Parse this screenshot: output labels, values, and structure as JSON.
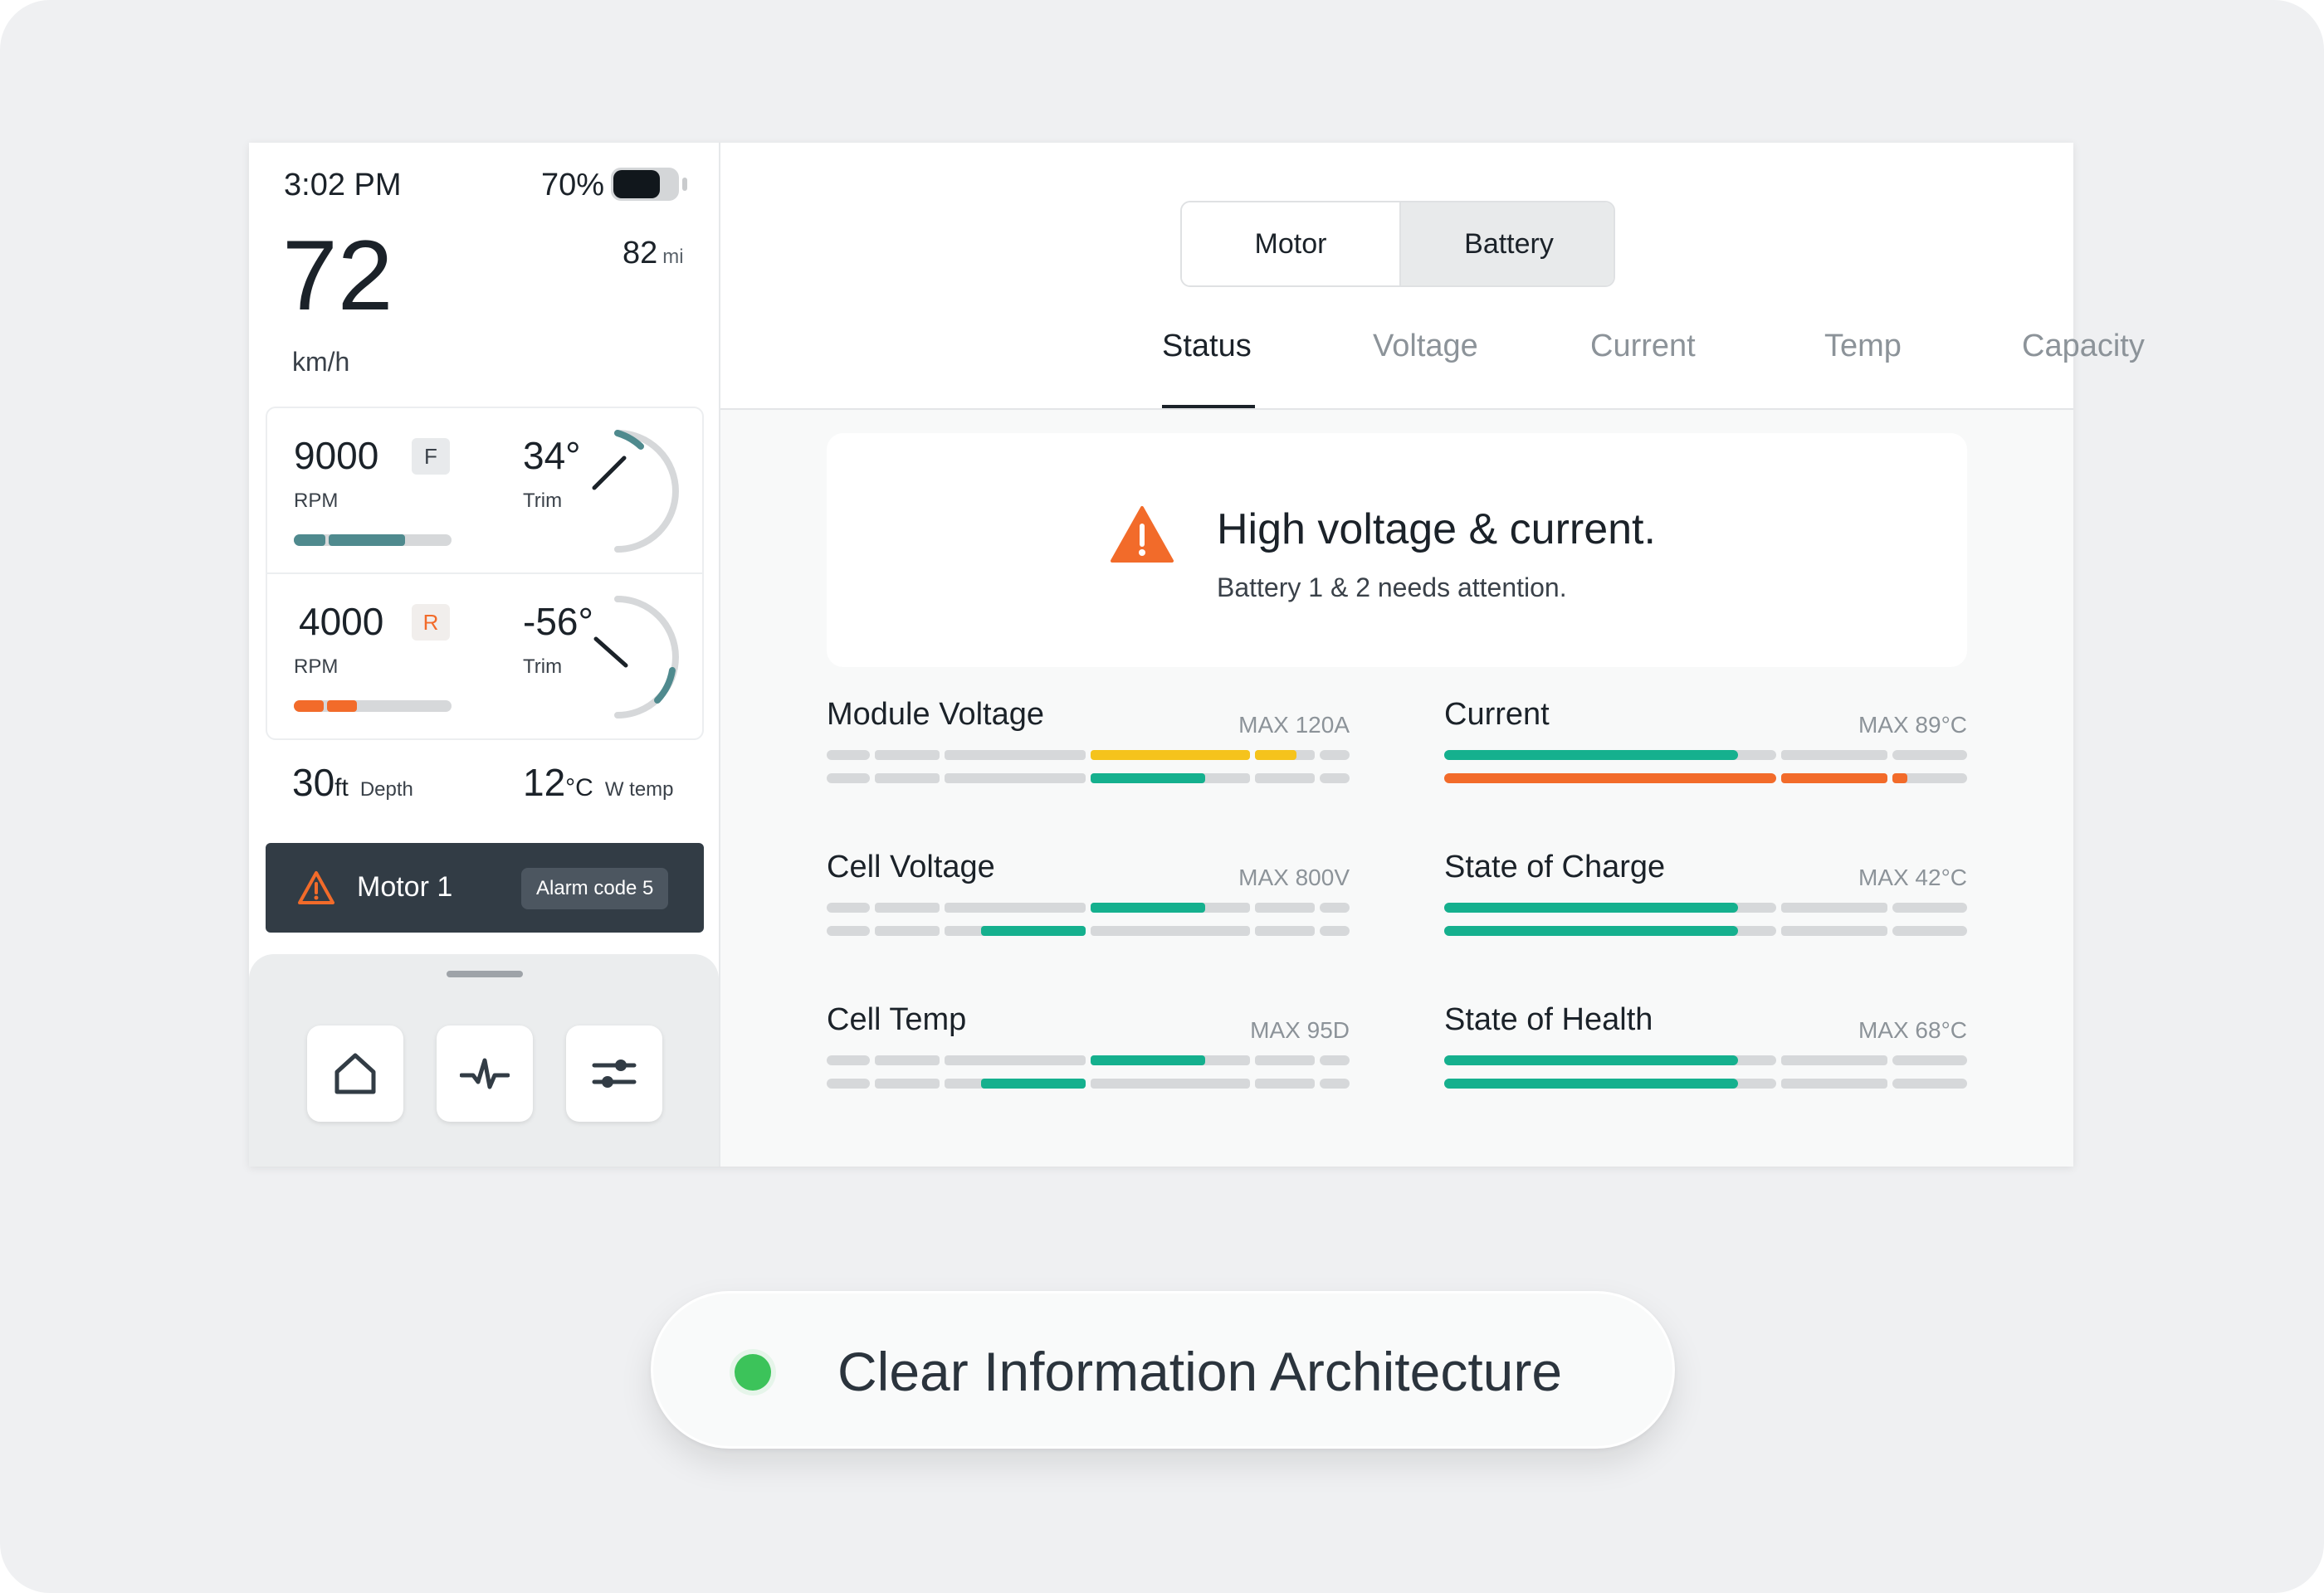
{
  "status_bar": {
    "time": "3:02 PM",
    "battery_percent": "70%",
    "battery_level": 0.7
  },
  "speed": {
    "value": "72",
    "unit": "km/h"
  },
  "range": {
    "value": "82",
    "unit": "mi"
  },
  "motors": [
    {
      "rpm": "9000",
      "rpm_label": "RPM",
      "gear": "F",
      "trim": "34°",
      "trim_label": "Trim",
      "rpm_fraction": 0.7
    },
    {
      "rpm": "4000",
      "rpm_label": "RPM",
      "gear": "R",
      "trim": "-56°",
      "trim_label": "Trim",
      "rpm_fraction": 0.4
    }
  ],
  "depth": {
    "value": "30",
    "unit": "ft",
    "label": "Depth"
  },
  "water_temp": {
    "value": "12",
    "unit": "°C",
    "label": "W temp"
  },
  "alarm": {
    "title": "Motor 1",
    "code": "Alarm code 5"
  },
  "nav": {
    "items": [
      "home-icon",
      "pulse-icon",
      "sliders-icon"
    ]
  },
  "segment": {
    "motor": "Motor",
    "battery": "Battery",
    "selected": "Battery"
  },
  "tabs": [
    "Status",
    "Voltage",
    "Current",
    "Temp",
    "Capacity"
  ],
  "active_tab": "Status",
  "alert": {
    "title": "High voltage & current.",
    "subtitle": "Battery 1 & 2 needs attention."
  },
  "metrics": [
    {
      "name": "Module Voltage",
      "max": "MAX 120A"
    },
    {
      "name": "Current",
      "max": "MAX 89°C"
    },
    {
      "name": "Cell Voltage",
      "max": "MAX 800V"
    },
    {
      "name": "State of Charge",
      "max": "MAX 42°C"
    },
    {
      "name": "Cell Temp",
      "max": "MAX 95D"
    },
    {
      "name": "State of Health",
      "max": "MAX 68°C"
    }
  ],
  "colors": {
    "teal": "#15b08e",
    "orange": "#f26b2a",
    "yellow": "#f5c31c",
    "gray": "#d6d8da",
    "dark_teal": "#4f8a8e",
    "green_dot": "#3cc35a"
  },
  "caption": "Clear Information Architecture"
}
